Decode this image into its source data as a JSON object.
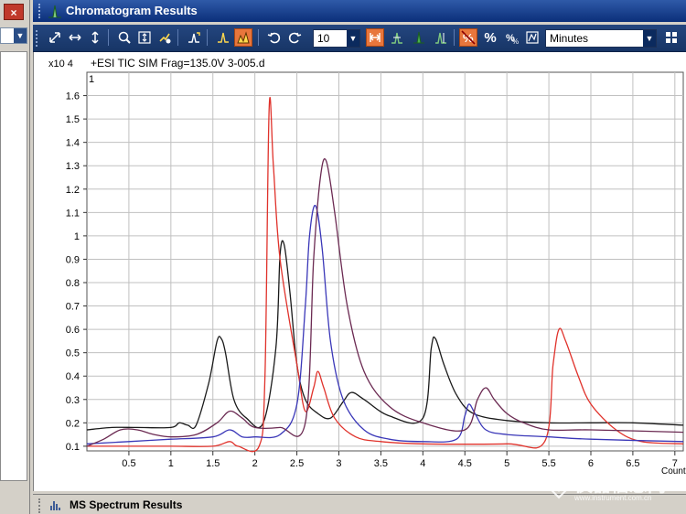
{
  "window": {
    "title": "Chromatogram Results",
    "bottom_panel_title": "MS Spectrum Results",
    "close_glyph": "×"
  },
  "toolbar": {
    "items": [
      "autoscale-xy-icon",
      "autoscale-x-icon",
      "autoscale-y-icon",
      "zoom-icon",
      "fit-y-icon",
      "properties-icon",
      "integrate-icon",
      "peak-label-icon",
      "peak-fill-icon",
      "undo-icon",
      "redo-icon"
    ],
    "number_value": "10",
    "units_value": "Minutes",
    "percent_glyph": "%"
  },
  "colors": {
    "toolbar_bg": "#1f3f78",
    "title_bg": "#1a46a0",
    "trace_black": "#1a1a1a",
    "trace_red": "#e0322b",
    "trace_blue": "#3a37b8",
    "trace_purple": "#6b2a52",
    "grid": "#c0c0c0",
    "active_button": "#e8763c"
  },
  "chart_data": {
    "type": "line",
    "title": "+ESI TIC SIM Frag=135.0V 3-005.d",
    "panel_index": "1",
    "y_exponent_label": "x10 4",
    "xlabel": "Counts vs. Acquisition Time (min)",
    "xlim": [
      0,
      7.1
    ],
    "ylim": [
      0.08,
      1.7
    ],
    "x_ticks": [
      "0.5",
      "1",
      "1.5",
      "2",
      "2.5",
      "3",
      "3.5",
      "4",
      "4.5",
      "5",
      "5.5",
      "6",
      "6.5",
      "7"
    ],
    "y_ticks": [
      "0.1",
      "0.2",
      "0.3",
      "0.4",
      "0.5",
      "0.6",
      "0.7",
      "0.8",
      "0.9",
      "1",
      "1.1",
      "1.2",
      "1.3",
      "1.4",
      "1.5",
      "1.6"
    ],
    "series": [
      {
        "color": "#1a1a1a",
        "x": [
          0.0,
          0.3,
          0.6,
          1.0,
          1.1,
          1.2,
          1.3,
          1.45,
          1.55,
          1.6,
          1.65,
          1.75,
          1.9,
          2.1,
          2.25,
          2.3,
          2.35,
          2.42,
          2.5,
          2.6,
          2.75,
          2.9,
          3.05,
          3.15,
          3.3,
          3.6,
          4.0,
          4.1,
          4.15,
          4.25,
          4.4,
          4.6,
          5.0,
          5.5,
          6.0,
          6.5,
          7.1
        ],
        "y": [
          0.17,
          0.18,
          0.18,
          0.18,
          0.2,
          0.19,
          0.19,
          0.37,
          0.55,
          0.56,
          0.5,
          0.3,
          0.22,
          0.2,
          0.52,
          0.92,
          0.96,
          0.75,
          0.45,
          0.3,
          0.24,
          0.22,
          0.29,
          0.33,
          0.3,
          0.23,
          0.22,
          0.52,
          0.56,
          0.45,
          0.32,
          0.24,
          0.21,
          0.2,
          0.2,
          0.2,
          0.19
        ]
      },
      {
        "color": "#e0322b",
        "x": [
          0.0,
          0.5,
          1.0,
          1.5,
          1.7,
          1.8,
          2.05,
          2.12,
          2.17,
          2.22,
          2.3,
          2.5,
          2.6,
          2.7,
          2.75,
          2.82,
          2.95,
          3.2,
          3.5,
          4.0,
          5.0,
          5.45,
          5.55,
          5.62,
          5.7,
          5.85,
          6.0,
          6.3,
          6.6,
          7.1
        ],
        "y": [
          0.1,
          0.1,
          0.1,
          0.1,
          0.12,
          0.1,
          0.1,
          0.4,
          1.55,
          1.3,
          0.9,
          0.45,
          0.25,
          0.35,
          0.42,
          0.35,
          0.22,
          0.14,
          0.12,
          0.11,
          0.11,
          0.12,
          0.45,
          0.6,
          0.55,
          0.4,
          0.28,
          0.17,
          0.12,
          0.11
        ]
      },
      {
        "color": "#3a37b8",
        "x": [
          0.0,
          0.5,
          1.0,
          1.5,
          1.7,
          1.85,
          2.0,
          2.3,
          2.5,
          2.6,
          2.65,
          2.72,
          2.8,
          2.9,
          3.05,
          3.3,
          3.6,
          4.0,
          4.4,
          4.5,
          4.55,
          4.62,
          4.75,
          5.0,
          5.5,
          6.0,
          7.1
        ],
        "y": [
          0.11,
          0.12,
          0.13,
          0.14,
          0.17,
          0.14,
          0.14,
          0.15,
          0.28,
          0.7,
          1.0,
          1.13,
          0.95,
          0.55,
          0.3,
          0.17,
          0.13,
          0.12,
          0.13,
          0.23,
          0.28,
          0.24,
          0.17,
          0.15,
          0.14,
          0.13,
          0.12
        ]
      },
      {
        "color": "#6b2a52",
        "x": [
          0.0,
          0.2,
          0.4,
          0.6,
          0.8,
          1.0,
          1.3,
          1.55,
          1.7,
          1.85,
          2.0,
          2.3,
          2.6,
          2.7,
          2.78,
          2.85,
          2.95,
          3.1,
          3.3,
          3.6,
          4.0,
          4.5,
          4.65,
          4.75,
          4.85,
          5.0,
          5.2,
          5.5,
          6.0,
          7.1
        ],
        "y": [
          0.1,
          0.13,
          0.17,
          0.17,
          0.15,
          0.14,
          0.15,
          0.2,
          0.25,
          0.22,
          0.18,
          0.18,
          0.2,
          0.9,
          1.25,
          1.32,
          1.1,
          0.7,
          0.42,
          0.27,
          0.2,
          0.17,
          0.3,
          0.35,
          0.3,
          0.24,
          0.2,
          0.17,
          0.17,
          0.16
        ]
      }
    ],
    "grid": true
  },
  "watermark": {
    "text": "仪器信息网",
    "url": "www.instrument.com.cn"
  }
}
